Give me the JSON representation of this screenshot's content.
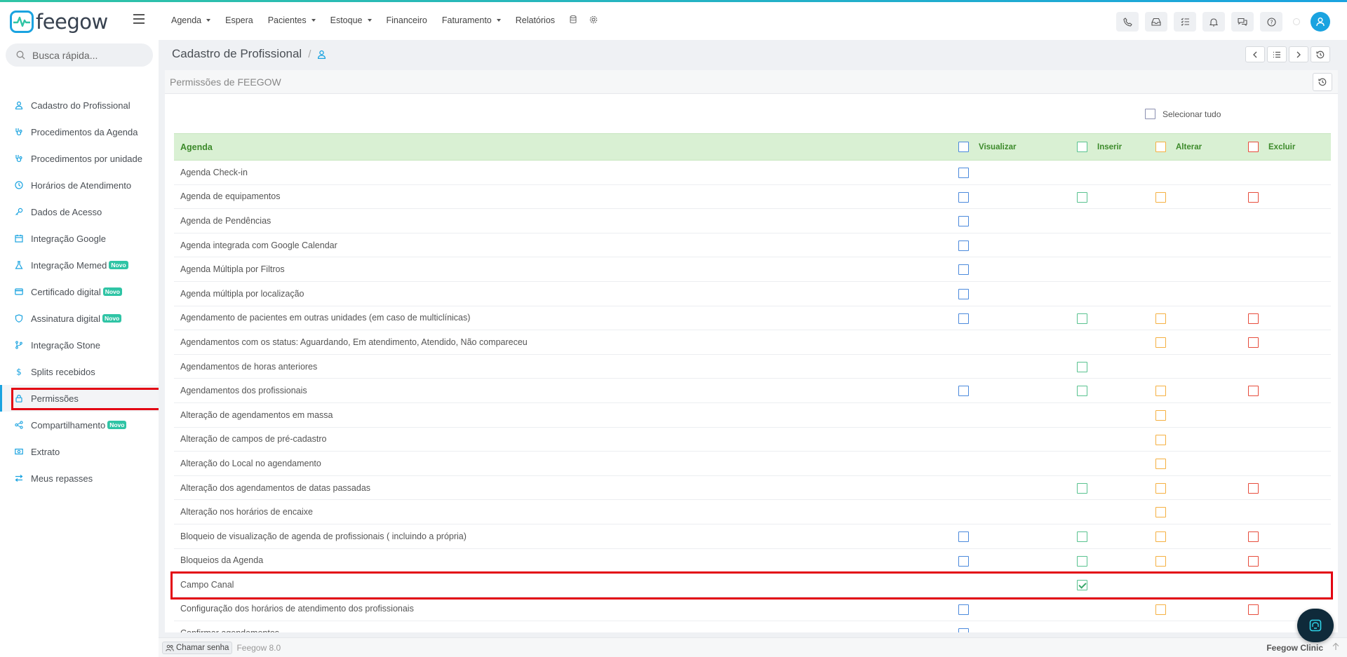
{
  "app": {
    "logo_text": "feegow",
    "brand_color": "#1aa3e0"
  },
  "nav": {
    "items": [
      {
        "label": "Agenda",
        "dropdown": true
      },
      {
        "label": "Espera",
        "dropdown": false
      },
      {
        "label": "Pacientes",
        "dropdown": true
      },
      {
        "label": "Estoque",
        "dropdown": true
      },
      {
        "label": "Financeiro",
        "dropdown": false
      },
      {
        "label": "Faturamento",
        "dropdown": true
      },
      {
        "label": "Relatórios",
        "dropdown": false
      }
    ]
  },
  "search": {
    "placeholder": "Busca rápida..."
  },
  "sidebar": {
    "items": [
      {
        "label": "Cadastro do Profissional",
        "icon": "user-icon",
        "novo": false
      },
      {
        "label": "Procedimentos da Agenda",
        "icon": "stethoscope-icon",
        "novo": false
      },
      {
        "label": "Procedimentos por unidade",
        "icon": "stethoscope-icon",
        "novo": false
      },
      {
        "label": "Horários de Atendimento",
        "icon": "clock-icon",
        "novo": false
      },
      {
        "label": "Dados de Acesso",
        "icon": "key-icon",
        "novo": false
      },
      {
        "label": "Integração Google",
        "icon": "calendar-icon",
        "novo": false
      },
      {
        "label": "Integração Memed",
        "icon": "flask-icon",
        "novo": true
      },
      {
        "label": "Certificado digital",
        "icon": "card-icon",
        "novo": true
      },
      {
        "label": "Assinatura digital",
        "icon": "shield-icon",
        "novo": true
      },
      {
        "label": "Integração Stone",
        "icon": "branch-icon",
        "novo": false
      },
      {
        "label": "Splits recebidos",
        "icon": "dollar-icon",
        "novo": false
      },
      {
        "label": "Permissões",
        "icon": "lock-icon",
        "novo": false,
        "active": true
      },
      {
        "label": "Compartilhamento",
        "icon": "share-icon",
        "novo": true
      },
      {
        "label": "Extrato",
        "icon": "money-icon",
        "novo": false
      },
      {
        "label": "Meus repasses",
        "icon": "transfer-icon",
        "novo": false
      }
    ],
    "novo_label": "Novo"
  },
  "page": {
    "title": "Cadastro de Profissional",
    "separator": "/"
  },
  "panel": {
    "title": "Permissões de FEEGOW",
    "select_all": "Selecionar tudo",
    "section": "Agenda",
    "columns": {
      "vis": "Visualizar",
      "ins": "Inserir",
      "alt": "Alterar",
      "exc": "Excluir"
    },
    "rows": [
      {
        "name": "Agenda Check-in",
        "vis": true,
        "ins": false,
        "alt": false,
        "exc": false
      },
      {
        "name": "Agenda de equipamentos",
        "vis": true,
        "ins": true,
        "alt": true,
        "exc": true
      },
      {
        "name": "Agenda de Pendências",
        "vis": true,
        "ins": false,
        "alt": false,
        "exc": false
      },
      {
        "name": "Agenda integrada com Google Calendar",
        "vis": true,
        "ins": false,
        "alt": false,
        "exc": false
      },
      {
        "name": "Agenda Múltipla por Filtros",
        "vis": true,
        "ins": false,
        "alt": false,
        "exc": false
      },
      {
        "name": "Agenda múltipla por localização",
        "vis": true,
        "ins": false,
        "alt": false,
        "exc": false
      },
      {
        "name": "Agendamento de pacientes em outras unidades (em caso de multiclínicas)",
        "vis": true,
        "ins": true,
        "alt": true,
        "exc": true
      },
      {
        "name": "Agendamentos com os status: Aguardando, Em atendimento, Atendido, Não compareceu",
        "vis": false,
        "ins": false,
        "alt": true,
        "exc": true
      },
      {
        "name": "Agendamentos de horas anteriores",
        "vis": false,
        "ins": true,
        "alt": false,
        "exc": false
      },
      {
        "name": "Agendamentos dos profissionais",
        "vis": true,
        "ins": true,
        "alt": true,
        "exc": true
      },
      {
        "name": "Alteração de agendamentos em massa",
        "vis": false,
        "ins": false,
        "alt": true,
        "exc": false
      },
      {
        "name": "Alteração de campos de pré-cadastro",
        "vis": false,
        "ins": false,
        "alt": true,
        "exc": false
      },
      {
        "name": "Alteração do Local no agendamento",
        "vis": false,
        "ins": false,
        "alt": true,
        "exc": false
      },
      {
        "name": "Alteração dos agendamentos de datas passadas",
        "vis": false,
        "ins": true,
        "alt": true,
        "exc": true
      },
      {
        "name": "Alteração nos horários de encaixe",
        "vis": false,
        "ins": false,
        "alt": true,
        "exc": false
      },
      {
        "name": "Bloqueio de visualização de agenda de profissionais ( incluindo a própria)",
        "vis": true,
        "ins": true,
        "alt": true,
        "exc": true
      },
      {
        "name": "Bloqueios da Agenda",
        "vis": true,
        "ins": true,
        "alt": true,
        "exc": true
      },
      {
        "name": "Campo Canal",
        "vis": false,
        "ins": true,
        "alt": false,
        "exc": false,
        "ins_checked": true
      },
      {
        "name": "Configuração dos horários de atendimento dos profissionais",
        "vis": true,
        "ins": false,
        "alt": true,
        "exc": true
      },
      {
        "name": "Confirmar agendamentos",
        "vis": true,
        "ins": false,
        "alt": false,
        "exc": false
      }
    ]
  },
  "footer": {
    "chamar": "Chamar senha",
    "version": "Feegow 8.0",
    "clinic": "Feegow Clinic"
  }
}
